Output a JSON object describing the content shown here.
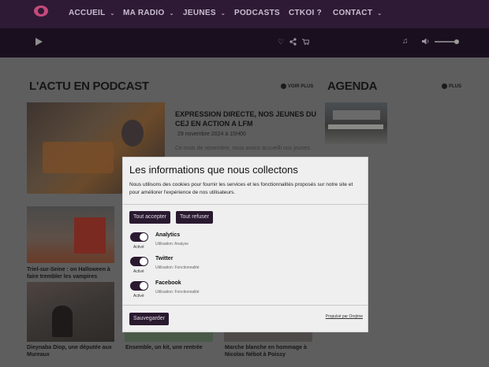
{
  "nav": {
    "items": [
      "ACCUEIL",
      "MA RADIO",
      "JEUNES",
      "PODCASTS",
      "CTKOI ?",
      "CONTACT"
    ],
    "chevron": "⌄"
  },
  "player": {
    "icons": [
      "play-icon",
      "heart-icon",
      "share-icon",
      "cart-icon",
      "music-note-icon",
      "volume-icon"
    ]
  },
  "podcast_section": {
    "title": "L'ACTU EN PODCAST",
    "more": "VOIR PLUS",
    "featured": {
      "headline": "EXPRESSION DIRECTE, NOS JEUNES DU CEJ EN ACTION A LFM",
      "date": "29 novembre 2024 à 15H00",
      "excerpt": "Ce mois de novembre, nous avons accueilli nos jeunes"
    },
    "items": [
      {
        "caption": "Triel-sur-Seine : on Halloween à faire trembler les vampires"
      },
      {
        "caption": "Dieynaba Diop, une députée aux Mureaux"
      },
      {
        "caption": "Ensemble, un kit, une rentrée"
      },
      {
        "caption": "Marche blanche en hommage à Nicolas Nébot à Poissy"
      }
    ]
  },
  "agenda": {
    "title": "AGENDA",
    "more": "PLUS"
  },
  "cookie": {
    "title": "Les informations que nous collectons",
    "text": "Nous utilisons des cookies pour fournir les services et les fonctionnalités proposés sur notre site et pour améliorer l'expérience de nos utilisateurs.",
    "accept": "Tout accepter",
    "refuse": "Tout refuser",
    "services": [
      {
        "name": "Analytics",
        "use": "Utilisation: Analyse",
        "state": "Activé"
      },
      {
        "name": "Twitter",
        "use": "Utilisation: Fonctionnalité",
        "state": "Activé"
      },
      {
        "name": "Facebook",
        "use": "Utilisation: Fonctionnalité",
        "state": "Activé"
      }
    ],
    "save": "Sauvegarder",
    "powered": "Propulsé par Orejime"
  },
  "colors": {
    "nav_bg": "#2e1a35",
    "player_bg": "#1a0f1e",
    "button_bg": "#2a1a30",
    "page_bg": "#5e5e5e"
  }
}
